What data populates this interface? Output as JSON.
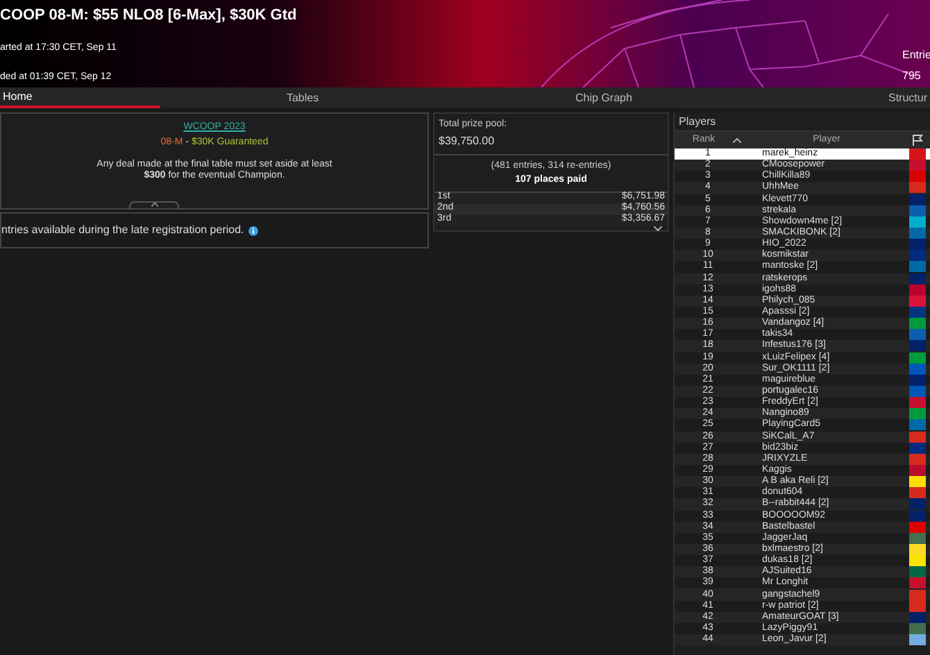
{
  "header": {
    "title": "COOP 08-M: $55 NLO8 [6-Max], $30K Gtd",
    "started": "arted at 17:30 CET, Sep 11",
    "ended": "ded at 01:39 CET, Sep 12",
    "entries_label": "Entrie",
    "entries_value": "795"
  },
  "tabs": [
    {
      "label": "Home",
      "selected": true
    },
    {
      "label": "Tables",
      "selected": false
    },
    {
      "label": "Chip Graph",
      "selected": false
    },
    {
      "label": "Structur",
      "selected": false
    }
  ],
  "info": {
    "series_link": "WCOOP 2023",
    "event_code": "08-M",
    "separator": " - ",
    "guarantee": "$30K Guaranteed",
    "deal_note": "Any deal made at the final table must set aside at least **$300** for the eventual Champion.",
    "late_reg_note": "ntries available during the late registration period."
  },
  "prizes": {
    "pool_label": "Total prize pool:",
    "pool_value": "$39,750.00",
    "entries_note": "(481 entries, 314 re-entries)",
    "places_paid": "107 places paid",
    "rows": [
      {
        "place": "1st",
        "amount": "$6,751.98"
      },
      {
        "place": "2nd",
        "amount": "$4,760.56"
      },
      {
        "place": "3rd",
        "amount": "$3,356.67"
      }
    ]
  },
  "players": {
    "title": "Players",
    "columns": [
      "Rank",
      "Player"
    ],
    "rows": [
      {
        "rank": "1",
        "name": "marek_heinz",
        "selected": true,
        "color": "#d7141a"
      },
      {
        "rank": "2",
        "name": "CMoosepower",
        "selected": false,
        "color": "#c8102e"
      },
      {
        "rank": "3",
        "name": "ChillKilla89",
        "selected": false,
        "color": "#dd0000"
      },
      {
        "rank": "4",
        "name": "UhhMee",
        "selected": false,
        "color": "#d52b1e"
      },
      {
        "rank": "5",
        "name": "Klevett770",
        "selected": false,
        "color": "#012169"
      },
      {
        "rank": "6",
        "name": "strekala",
        "selected": false,
        "color": "#0d5eaf"
      },
      {
        "rank": "7",
        "name": "Showdown4me [2]",
        "selected": false,
        "color": "#00afca"
      },
      {
        "rank": "8",
        "name": "SMACKIBONK [2]",
        "selected": false,
        "color": "#006aa7"
      },
      {
        "rank": "9",
        "name": "HIO_2022",
        "selected": false,
        "color": "#012169"
      },
      {
        "rank": "10",
        "name": "kosmikstar",
        "selected": false,
        "color": "#002b7f"
      },
      {
        "rank": "11",
        "name": "mantoske [2]",
        "selected": false,
        "color": "#006aa7"
      },
      {
        "rank": "12",
        "name": "ratskerops",
        "selected": false,
        "color": "#012169"
      },
      {
        "rank": "13",
        "name": "igohs88",
        "selected": false,
        "color": "#bc002d"
      },
      {
        "rank": "14",
        "name": "Philych_085",
        "selected": false,
        "color": "#dc143c"
      },
      {
        "rank": "15",
        "name": "Apasssi [2]",
        "selected": false,
        "color": "#003580"
      },
      {
        "rank": "16",
        "name": "Vandangoz [4]",
        "selected": false,
        "color": "#009c3b"
      },
      {
        "rank": "17",
        "name": "takis34",
        "selected": false,
        "color": "#0d5eaf"
      },
      {
        "rank": "18",
        "name": "Infestus176 [3]",
        "selected": false,
        "color": "#012169"
      },
      {
        "rank": "19",
        "name": "xLuizFelipex [4]",
        "selected": false,
        "color": "#009c3b"
      },
      {
        "rank": "20",
        "name": "Sur_OK1111 [2]",
        "selected": false,
        "color": "#0057b7"
      },
      {
        "rank": "21",
        "name": "maguireblue",
        "selected": false,
        "color": "#012169"
      },
      {
        "rank": "22",
        "name": "portugalec16",
        "selected": false,
        "color": "#0057b7"
      },
      {
        "rank": "23",
        "name": "FreddyErt [2]",
        "selected": false,
        "color": "#c8102e"
      },
      {
        "rank": "24",
        "name": "Nangino89",
        "selected": false,
        "color": "#009c3b"
      },
      {
        "rank": "25",
        "name": "PlayingCard5",
        "selected": false,
        "color": "#006aa7"
      },
      {
        "rank": "26",
        "name": "SiKCalL_A7",
        "selected": false,
        "color": "#d52b1e"
      },
      {
        "rank": "27",
        "name": "bid23biz",
        "selected": false,
        "color": "#002b7f"
      },
      {
        "rank": "28",
        "name": "JRIXYZLE",
        "selected": false,
        "color": "#d52b1e"
      },
      {
        "rank": "29",
        "name": "Kaggis",
        "selected": false,
        "color": "#ba0c2f"
      },
      {
        "rank": "30",
        "name": "A B aka Reli [2]",
        "selected": false,
        "color": "#fcdd09"
      },
      {
        "rank": "31",
        "name": "donut604",
        "selected": false,
        "color": "#d52b1e"
      },
      {
        "rank": "32",
        "name": "B--rabbit444 [2]",
        "selected": false,
        "color": "#012169"
      },
      {
        "rank": "33",
        "name": "BOOOOOM92",
        "selected": false,
        "color": "#012169"
      },
      {
        "rank": "34",
        "name": "Bastelbastel",
        "selected": false,
        "color": "#dd0000"
      },
      {
        "rank": "35",
        "name": "JaggerJaq",
        "selected": false,
        "color": "#436f4d"
      },
      {
        "rank": "36",
        "name": "bxlmaestro [2]",
        "selected": false,
        "color": "#fdda24"
      },
      {
        "rank": "37",
        "name": "dukas18 [2]",
        "selected": false,
        "color": "#f9e300"
      },
      {
        "rank": "38",
        "name": "AJSuited16",
        "selected": false,
        "color": "#006847"
      },
      {
        "rank": "39",
        "name": "Mr Longhit",
        "selected": false,
        "color": "#c8102e"
      },
      {
        "rank": "40",
        "name": "gangstachel9",
        "selected": false,
        "color": "#d52b1e"
      },
      {
        "rank": "41",
        "name": "r-w patriot [2]",
        "selected": false,
        "color": "#d52b1e"
      },
      {
        "rank": "42",
        "name": "AmateurGOAT [3]",
        "selected": false,
        "color": "#012169"
      },
      {
        "rank": "43",
        "name": "LazyPiggy91",
        "selected": false,
        "color": "#436f4d"
      },
      {
        "rank": "44",
        "name": "Leon_Javur [2]",
        "selected": false,
        "color": "#74acdf"
      }
    ]
  }
}
